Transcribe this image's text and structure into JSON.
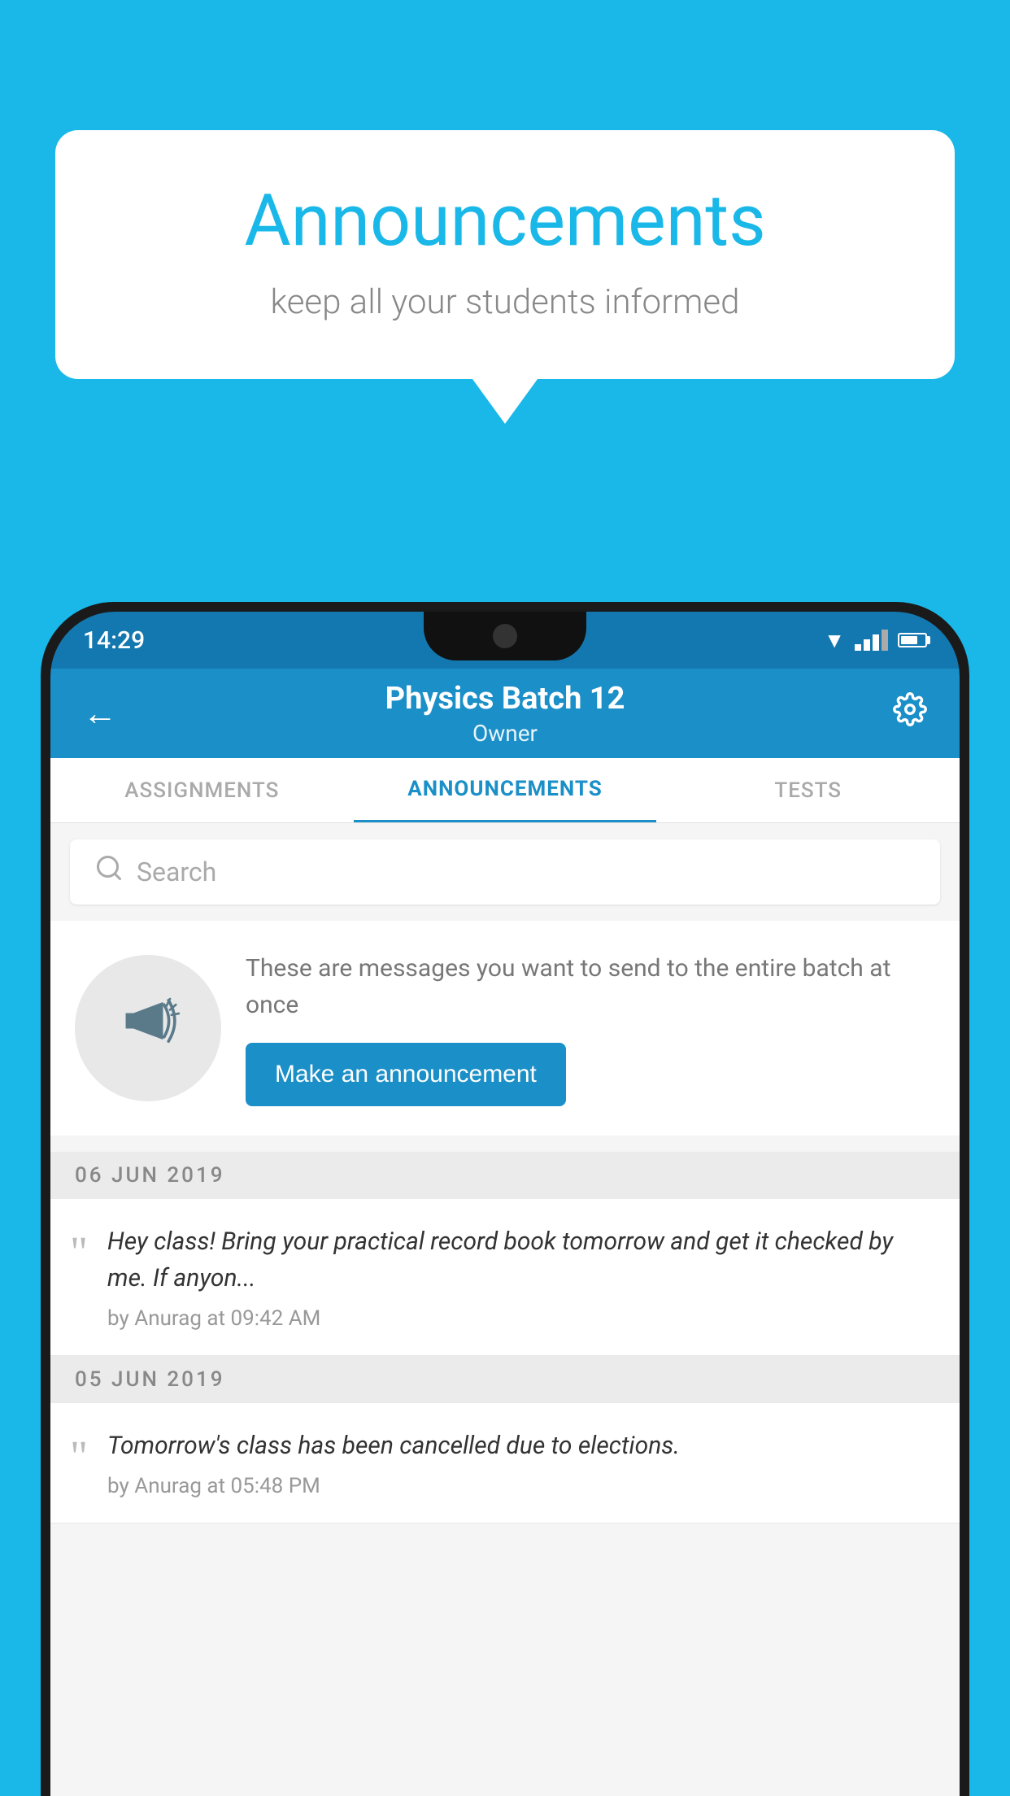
{
  "page": {
    "background_color": "#1ab8e8"
  },
  "speech_bubble": {
    "title": "Announcements",
    "subtitle": "keep all your students informed"
  },
  "phone": {
    "status_bar": {
      "time": "14:29"
    },
    "header": {
      "batch_name": "Physics Batch 12",
      "role": "Owner",
      "back_label": "←",
      "settings_label": "⚙"
    },
    "tabs": [
      {
        "label": "ASSIGNMENTS",
        "active": false
      },
      {
        "label": "ANNOUNCEMENTS",
        "active": true
      },
      {
        "label": "TESTS",
        "active": false
      }
    ],
    "search": {
      "placeholder": "Search"
    },
    "announcement_prompt": {
      "description": "These are messages you want to send to the entire batch at once",
      "button_label": "Make an announcement"
    },
    "announcements": [
      {
        "date": "06  JUN  2019",
        "message": "Hey class! Bring your practical record book tomorrow and get it checked by me. If anyon...",
        "meta": "by Anurag at 09:42 AM"
      },
      {
        "date": "05  JUN  2019",
        "message": "Tomorrow's class has been cancelled due to elections.",
        "meta": "by Anurag at 05:48 PM"
      }
    ]
  }
}
